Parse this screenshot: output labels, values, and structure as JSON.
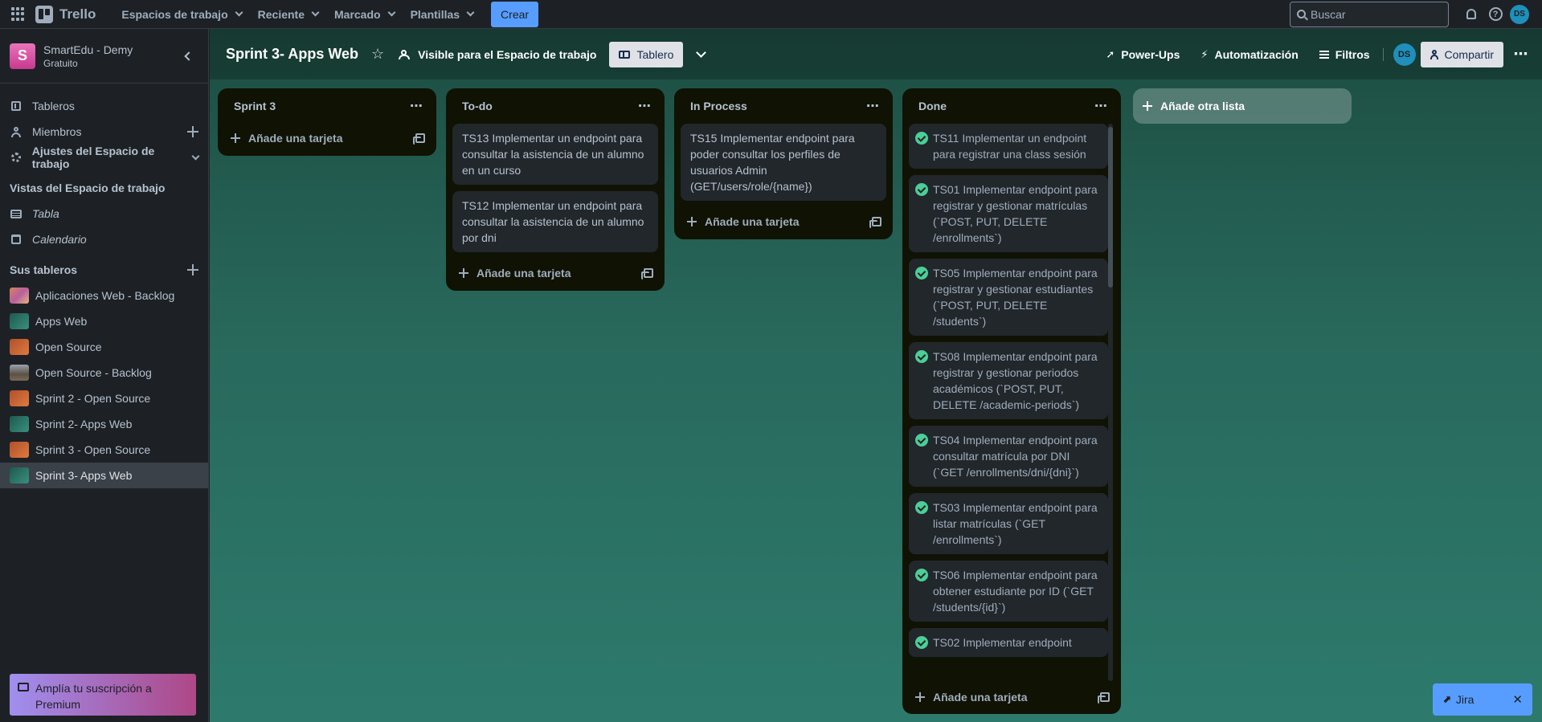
{
  "topbar": {
    "logo": "Trello",
    "nav": [
      {
        "label": "Espacios de trabajo"
      },
      {
        "label": "Reciente"
      },
      {
        "label": "Marcado"
      },
      {
        "label": "Plantillas"
      }
    ],
    "create_label": "Crear",
    "search_placeholder": "Buscar",
    "avatar_initials": "DS"
  },
  "sidebar": {
    "workspace_initial": "S",
    "workspace_name": "SmartEdu - Demy",
    "workspace_plan": "Gratuito",
    "items": [
      {
        "label": "Tableros"
      },
      {
        "label": "Miembros"
      },
      {
        "label": "Ajustes del Espacio de trabajo"
      }
    ],
    "views_heading": "Vistas del Espacio de trabajo",
    "views": [
      {
        "label": "Tabla"
      },
      {
        "label": "Calendario"
      }
    ],
    "boards_heading": "Sus tableros",
    "boards": [
      {
        "label": "Aplicaciones Web - Backlog",
        "color": "#c9766a"
      },
      {
        "label": "Apps Web",
        "color": "#2f7a6b"
      },
      {
        "label": "Open Source",
        "color": "#c2623a"
      },
      {
        "label": "Open Source - Backlog",
        "color": "#6e6a64"
      },
      {
        "label": "Sprint 2 - Open Source",
        "color": "#c2623a"
      },
      {
        "label": "Sprint 2- Apps Web",
        "color": "#2f7a6b"
      },
      {
        "label": "Sprint 3 - Open Source",
        "color": "#c2623a"
      },
      {
        "label": "Sprint 3- Apps Web",
        "color": "#2f7a6b"
      }
    ],
    "premium_label": "Amplía tu suscripción a Premium"
  },
  "board": {
    "title": "Sprint 3- Apps Web",
    "visibility": "Visible para el Espacio de trabajo",
    "view_label": "Tablero",
    "powerups": "Power-Ups",
    "automation": "Automatización",
    "filters": "Filtros",
    "member_initials": "DS",
    "share_label": "Compartir",
    "add_list_label": "Añade otra lista",
    "add_card_label": "Añade una tarjeta",
    "lists": [
      {
        "title": "Sprint 3",
        "cards": []
      },
      {
        "title": "To-do",
        "cards": [
          "TS13 Implementar un endpoint para consultar la asistencia de un alumno en un curso",
          "TS12 Implementar un endpoint para consultar la asistencia de un alumno por dni"
        ]
      },
      {
        "title": "In Process",
        "cards": [
          "TS15 Implementar endpoint para poder consultar los perfiles de usuarios Admin (GET/users/role/{name})"
        ]
      },
      {
        "title": "Done",
        "cards": [
          "TS11 Implementar un endpoint para registrar una class sesión",
          "TS01 Implementar endpoint para registrar y gestionar matrículas (`POST, PUT, DELETE /enrollments`)",
          "TS05 Implementar endpoint para registrar y gestionar estudiantes (`POST, PUT, DELETE /students`)",
          "TS08 Implementar endpoint para registrar y gestionar periodos académicos (`POST, PUT, DELETE /academic-periods`)",
          "TS04 Implementar endpoint para consultar matrícula por DNI (`GET /enrollments/dni/{dni}`)",
          "TS03 Implementar endpoint para listar matrículas (`GET /enrollments`)",
          "TS06 Implementar endpoint para obtener estudiante por ID (`GET /students/{id}`)",
          "TS02 Implementar endpoint"
        ]
      }
    ]
  },
  "jira": {
    "label": "Jira",
    "close": "✕"
  }
}
